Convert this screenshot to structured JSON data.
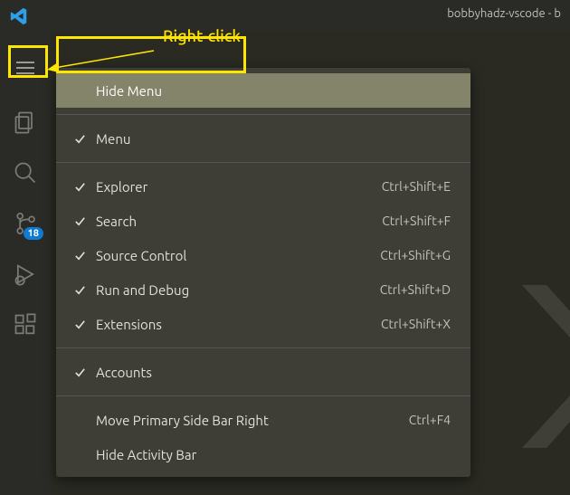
{
  "title": "bobbyhadz-vscode - b",
  "annotation": "Right-click",
  "activity_bar": {
    "source_control_badge": "18"
  },
  "context_menu": {
    "hide_menu": "Hide Menu",
    "items": [
      {
        "label": "Menu",
        "checked": true,
        "shortcut": ""
      },
      {
        "separator": true
      },
      {
        "label": "Explorer",
        "checked": true,
        "shortcut": "Ctrl+Shift+E"
      },
      {
        "label": "Search",
        "checked": true,
        "shortcut": "Ctrl+Shift+F"
      },
      {
        "label": "Source Control",
        "checked": true,
        "shortcut": "Ctrl+Shift+G"
      },
      {
        "label": "Run and Debug",
        "checked": true,
        "shortcut": "Ctrl+Shift+D"
      },
      {
        "label": "Extensions",
        "checked": true,
        "shortcut": "Ctrl+Shift+X"
      },
      {
        "separator": true
      },
      {
        "label": "Accounts",
        "checked": true,
        "shortcut": ""
      },
      {
        "separator": true
      },
      {
        "label": "Move Primary Side Bar Right",
        "checked": false,
        "shortcut": "Ctrl+F4"
      },
      {
        "label": "Hide Activity Bar",
        "checked": false,
        "shortcut": ""
      }
    ]
  }
}
